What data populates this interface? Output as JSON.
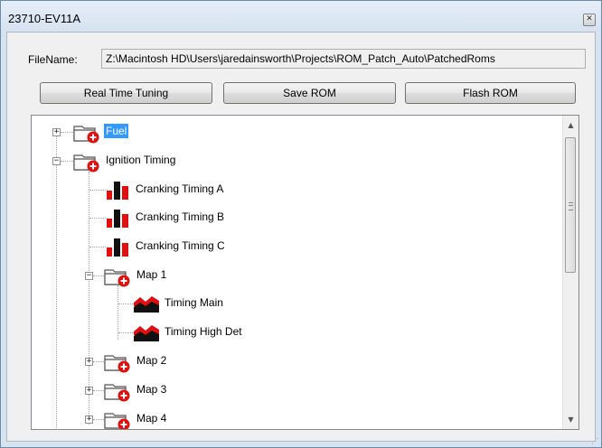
{
  "window": {
    "title": "23710-EV11A",
    "close_glyph": "✕"
  },
  "file": {
    "label": "FileName:",
    "path": "Z:\\Macintosh HD\\Users\\jaredainsworth\\Projects\\ROM_Patch_Auto\\PatchedRoms"
  },
  "toolbar": {
    "realtime_label": "Real Time Tuning",
    "save_label": "Save ROM",
    "flash_label": "Flash ROM"
  },
  "tree": {
    "fuel": "Fuel",
    "ignition": "Ignition Timing",
    "crank_a": "Cranking Timing A",
    "crank_b": "Cranking Timing B",
    "crank_c": "Cranking Timing C",
    "map1": "Map 1",
    "timing_main": "Timing Main",
    "timing_high": "Timing High Det",
    "map2": "Map 2",
    "map3": "Map 3",
    "map4": "Map 4"
  },
  "icons": {
    "folder": "folder-with-red-badge-icon",
    "table2d": "bar-chart-icon",
    "table3d": "area-chart-icon"
  },
  "colors": {
    "selection": "#3399ff",
    "badge_red": "#e01010"
  }
}
